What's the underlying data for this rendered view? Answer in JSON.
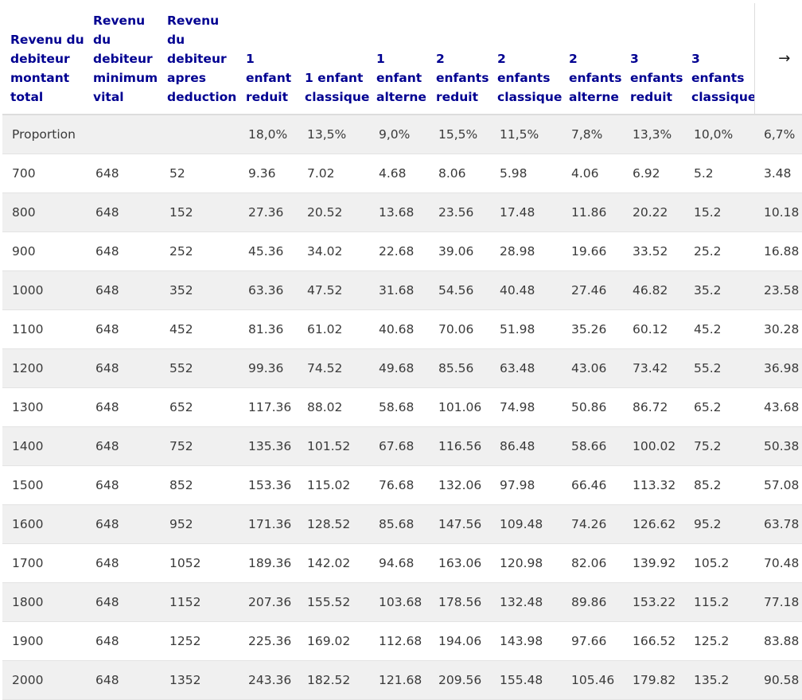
{
  "table": {
    "headers": [
      [
        "Revenu du",
        "debiteur",
        "montant",
        "total"
      ],
      [
        "Revenu",
        "du",
        "debiteur",
        "minimum",
        "vital"
      ],
      [
        "Revenu",
        "du",
        "debiteur",
        "apres",
        "deduction"
      ],
      [
        "1",
        "enfant",
        "reduit"
      ],
      [
        "1 enfant",
        "classique"
      ],
      [
        "1",
        "enfant",
        "alterne"
      ],
      [
        "2",
        "enfants",
        "reduit"
      ],
      [
        "2",
        "enfants",
        "classique"
      ],
      [
        "2",
        "enfants",
        "alterne"
      ],
      [
        "3",
        "enfants",
        "reduit"
      ],
      [
        "3",
        "enfants",
        "classique"
      ]
    ],
    "scroll_icon": "→",
    "rows": [
      [
        "Proportion",
        "",
        "",
        "18,0%",
        "13,5%",
        "9,0%",
        "15,5%",
        "11,5%",
        "7,8%",
        "13,3%",
        "10,0%",
        "6,7%"
      ],
      [
        "700",
        "648",
        "52",
        "9.36",
        "7.02",
        "4.68",
        "8.06",
        "5.98",
        "4.06",
        "6.92",
        "5.2",
        "3.48"
      ],
      [
        "800",
        "648",
        "152",
        "27.36",
        "20.52",
        "13.68",
        "23.56",
        "17.48",
        "11.86",
        "20.22",
        "15.2",
        "10.18"
      ],
      [
        "900",
        "648",
        "252",
        "45.36",
        "34.02",
        "22.68",
        "39.06",
        "28.98",
        "19.66",
        "33.52",
        "25.2",
        "16.88"
      ],
      [
        "1000",
        "648",
        "352",
        "63.36",
        "47.52",
        "31.68",
        "54.56",
        "40.48",
        "27.46",
        "46.82",
        "35.2",
        "23.58"
      ],
      [
        "1100",
        "648",
        "452",
        "81.36",
        "61.02",
        "40.68",
        "70.06",
        "51.98",
        "35.26",
        "60.12",
        "45.2",
        "30.28"
      ],
      [
        "1200",
        "648",
        "552",
        "99.36",
        "74.52",
        "49.68",
        "85.56",
        "63.48",
        "43.06",
        "73.42",
        "55.2",
        "36.98"
      ],
      [
        "1300",
        "648",
        "652",
        "117.36",
        "88.02",
        "58.68",
        "101.06",
        "74.98",
        "50.86",
        "86.72",
        "65.2",
        "43.68"
      ],
      [
        "1400",
        "648",
        "752",
        "135.36",
        "101.52",
        "67.68",
        "116.56",
        "86.48",
        "58.66",
        "100.02",
        "75.2",
        "50.38"
      ],
      [
        "1500",
        "648",
        "852",
        "153.36",
        "115.02",
        "76.68",
        "132.06",
        "97.98",
        "66.46",
        "113.32",
        "85.2",
        "57.08"
      ],
      [
        "1600",
        "648",
        "952",
        "171.36",
        "128.52",
        "85.68",
        "147.56",
        "109.48",
        "74.26",
        "126.62",
        "95.2",
        "63.78"
      ],
      [
        "1700",
        "648",
        "1052",
        "189.36",
        "142.02",
        "94.68",
        "163.06",
        "120.98",
        "82.06",
        "139.92",
        "105.2",
        "70.48"
      ],
      [
        "1800",
        "648",
        "1152",
        "207.36",
        "155.52",
        "103.68",
        "178.56",
        "132.48",
        "89.86",
        "153.22",
        "115.2",
        "77.18"
      ],
      [
        "1900",
        "648",
        "1252",
        "225.36",
        "169.02",
        "112.68",
        "194.06",
        "143.98",
        "97.66",
        "166.52",
        "125.2",
        "83.88"
      ],
      [
        "2000",
        "648",
        "1352",
        "243.36",
        "182.52",
        "121.68",
        "209.56",
        "155.48",
        "105.46",
        "179.82",
        "135.2",
        "90.58"
      ]
    ]
  }
}
